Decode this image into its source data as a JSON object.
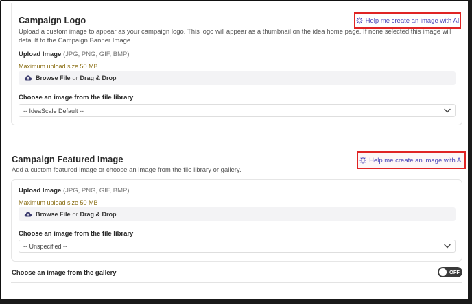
{
  "logo_section": {
    "title": "Campaign Logo",
    "description": "Upload a custom image to appear as your campaign logo. This logo will appear as a thumbnail on the idea home page. If none selected this image will default to the Campaign Banner Image.",
    "ai_button": "Help me create an image with AI",
    "upload_label": "Upload Image",
    "upload_formats": "(JPG, PNG, GIF, BMP)",
    "max_size": "Maximum upload size 50 MB",
    "browse": "Browse File",
    "or": "or",
    "drag": "Drag & Drop",
    "library_label": "Choose an image from the file library",
    "library_selected": "-- IdeaScale Default --"
  },
  "featured_section": {
    "title": "Campaign Featured Image",
    "description": "Add a custom featured image or choose an image from the file library or gallery.",
    "ai_button": "Help me create an image with AI",
    "upload_label": "Upload Image",
    "upload_formats": "(JPG, PNG, GIF, BMP)",
    "max_size": "Maximum upload size 50 MB",
    "browse": "Browse File",
    "or": "or",
    "drag": "Drag & Drop",
    "library_label": "Choose an image from the file library",
    "library_selected": "-- Unspecified --"
  },
  "gallery": {
    "label": "Choose an image from the gallery",
    "toggle_state": "OFF"
  },
  "colors": {
    "accent": "#4a45b8",
    "highlight_border": "#e02424",
    "max_size_text": "#8a6d12",
    "toggle_bg": "#3a3a3a"
  }
}
